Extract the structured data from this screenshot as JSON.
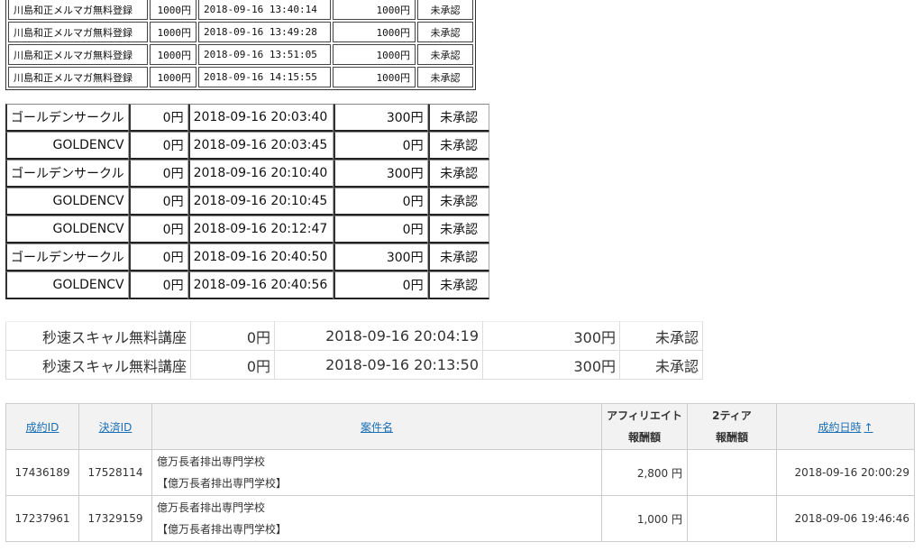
{
  "mail_magazine": {
    "rows": [
      {
        "name": "川島和正メルマガ無料登録",
        "price": "1000円",
        "datetime": "2018-09-16 13:40:14",
        "reward": "1000円",
        "status": "未承認"
      },
      {
        "name": "川島和正メルマガ無料登録",
        "price": "1000円",
        "datetime": "2018-09-16 13:49:28",
        "reward": "1000円",
        "status": "未承認"
      },
      {
        "name": "川島和正メルマガ無料登録",
        "price": "1000円",
        "datetime": "2018-09-16 13:51:05",
        "reward": "1000円",
        "status": "未承認"
      },
      {
        "name": "川島和正メルマガ無料登録",
        "price": "1000円",
        "datetime": "2018-09-16 14:15:55",
        "reward": "1000円",
        "status": "未承認"
      }
    ]
  },
  "golden_circle": {
    "rows": [
      {
        "name": "ゴールデンサークル",
        "price": "0円",
        "datetime": "2018-09-16 20:03:40",
        "reward": "300円",
        "status": "未承認"
      },
      {
        "name": "GOLDENCV",
        "price": "0円",
        "datetime": "2018-09-16 20:03:45",
        "reward": "0円",
        "status": "未承認"
      },
      {
        "name": "ゴールデンサークル",
        "price": "0円",
        "datetime": "2018-09-16 20:10:40",
        "reward": "300円",
        "status": "未承認"
      },
      {
        "name": "GOLDENCV",
        "price": "0円",
        "datetime": "2018-09-16 20:10:45",
        "reward": "0円",
        "status": "未承認"
      },
      {
        "name": "GOLDENCV",
        "price": "0円",
        "datetime": "2018-09-16 20:12:47",
        "reward": "0円",
        "status": "未承認"
      },
      {
        "name": "ゴールデンサークル",
        "price": "0円",
        "datetime": "2018-09-16 20:40:50",
        "reward": "300円",
        "status": "未承認"
      },
      {
        "name": "GOLDENCV",
        "price": "0円",
        "datetime": "2018-09-16 20:40:56",
        "reward": "0円",
        "status": "未承認"
      }
    ]
  },
  "scalping": {
    "rows": [
      {
        "name": "秒速スキャル無料講座",
        "price": "0円",
        "datetime": "2018-09-16 20:04:19",
        "reward": "300円",
        "status": "未承認"
      },
      {
        "name": "秒速スキャル無料講座",
        "price": "0円",
        "datetime": "2018-09-16 20:13:50",
        "reward": "300円",
        "status": "未承認"
      }
    ]
  },
  "results": {
    "headers": {
      "contract_id": "成約ID",
      "payment_id": "決済ID",
      "item_name": "案件名",
      "affiliate_line1": "アフィリエイト",
      "affiliate_line2": "報酬額",
      "tier_line1": "2ティア",
      "tier_line2": "報酬額",
      "contract_date": "成約日時",
      "sort_indicator": "↑"
    },
    "rows": [
      {
        "contract_id": "17436189",
        "payment_id": "17528114",
        "item_line1": "億万長者排出専門学校",
        "item_line2": "【億万長者排出専門学校】",
        "affiliate": "2,800 円",
        "tier": "",
        "date": "2018-09-16 20:00:29"
      },
      {
        "contract_id": "17237961",
        "payment_id": "17329159",
        "item_line1": "億万長者排出専門学校",
        "item_line2": "【億万長者排出専門学校】",
        "affiliate": "1,000 円",
        "tier": "",
        "date": "2018-09-06 19:46:46"
      }
    ]
  }
}
